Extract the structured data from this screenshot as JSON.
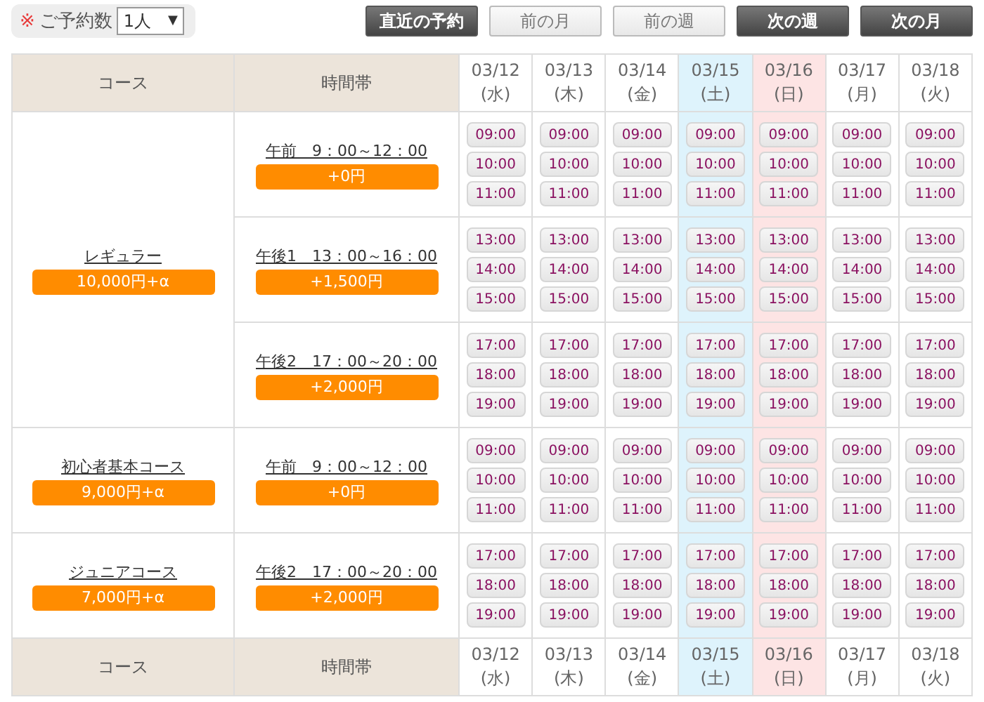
{
  "toolbar": {
    "count_label_mark": "※",
    "count_label": "ご予約数",
    "count_select": "1人",
    "count_select_arrow": "▼",
    "buttons": [
      {
        "label": "直近の予約",
        "disabled": false
      },
      {
        "label": "前の月",
        "disabled": true
      },
      {
        "label": "前の週",
        "disabled": true
      },
      {
        "label": "次の週",
        "disabled": false
      },
      {
        "label": "次の月",
        "disabled": false
      }
    ]
  },
  "table": {
    "header": {
      "course": "コース",
      "time": "時間帯",
      "days": [
        {
          "date": "03/12",
          "weekday": "(水)",
          "kind": "weekday"
        },
        {
          "date": "03/13",
          "weekday": "(木)",
          "kind": "weekday"
        },
        {
          "date": "03/14",
          "weekday": "(金)",
          "kind": "weekday"
        },
        {
          "date": "03/15",
          "weekday": "(土)",
          "kind": "saturday"
        },
        {
          "date": "03/16",
          "weekday": "(日)",
          "kind": "sunday"
        },
        {
          "date": "03/17",
          "weekday": "(月)",
          "kind": "weekday"
        },
        {
          "date": "03/18",
          "weekday": "(火)",
          "kind": "weekday"
        }
      ]
    },
    "courses": [
      {
        "name": "レギュラー",
        "price": "10,000円+α",
        "slots": [
          {
            "label": "午前　9：00～12：00",
            "extra": "+0円",
            "days": [
              [
                "09:00",
                "10:00",
                "11:00"
              ],
              [
                "09:00",
                "10:00",
                "11:00"
              ],
              [
                "09:00",
                "10:00",
                "11:00"
              ],
              [
                "09:00",
                "10:00",
                "11:00"
              ],
              [
                "09:00",
                "10:00",
                "11:00"
              ],
              [
                "09:00",
                "10:00",
                "11:00"
              ],
              [
                "09:00",
                "10:00",
                "11:00"
              ]
            ]
          },
          {
            "label": "午後1　13：00～16：00",
            "extra": "+1,500円",
            "days": [
              [
                "13:00",
                "14:00",
                "15:00"
              ],
              [
                "13:00",
                "14:00",
                "15:00"
              ],
              [
                "13:00",
                "14:00",
                "15:00"
              ],
              [
                "13:00",
                "14:00",
                "15:00"
              ],
              [
                "13:00",
                "14:00",
                "15:00"
              ],
              [
                "13:00",
                "14:00",
                "15:00"
              ],
              [
                "13:00",
                "14:00",
                "15:00"
              ]
            ]
          },
          {
            "label": "午後2　17：00～20：00",
            "extra": "+2,000円",
            "days": [
              [
                "17:00",
                "18:00",
                "19:00"
              ],
              [
                "17:00",
                "18:00",
                "19:00"
              ],
              [
                "17:00",
                "18:00",
                "19:00"
              ],
              [
                "17:00",
                "18:00",
                "19:00"
              ],
              [
                "17:00",
                "18:00",
                "19:00"
              ],
              [
                "17:00",
                "18:00",
                "19:00"
              ],
              [
                "17:00",
                "18:00",
                "19:00"
              ]
            ]
          }
        ]
      },
      {
        "name": "初心者基本コース",
        "price": "9,000円+α",
        "slots": [
          {
            "label": "午前　9：00～12：00",
            "extra": "+0円",
            "days": [
              [
                "09:00",
                "10:00",
                "11:00"
              ],
              [
                "09:00",
                "10:00",
                "11:00"
              ],
              [
                "09:00",
                "10:00",
                "11:00"
              ],
              [
                "09:00",
                "10:00",
                "11:00"
              ],
              [
                "09:00",
                "10:00",
                "11:00"
              ],
              [
                "09:00",
                "10:00",
                "11:00"
              ],
              [
                "09:00",
                "10:00",
                "11:00"
              ]
            ]
          }
        ]
      },
      {
        "name": "ジュニアコース",
        "price": "7,000円+α",
        "slots": [
          {
            "label": "午後2　17：00～20：00",
            "extra": "+2,000円",
            "days": [
              [
                "17:00",
                "18:00",
                "19:00"
              ],
              [
                "17:00",
                "18:00",
                "19:00"
              ],
              [
                "17:00",
                "18:00",
                "19:00"
              ],
              [
                "17:00",
                "18:00",
                "19:00"
              ],
              [
                "17:00",
                "18:00",
                "19:00"
              ],
              [
                "17:00",
                "18:00",
                "19:00"
              ],
              [
                "17:00",
                "18:00",
                "19:00"
              ]
            ]
          }
        ]
      }
    ],
    "footer": {
      "course": "コース",
      "time": "時間帯",
      "days": [
        {
          "date": "03/12",
          "weekday": "(水)",
          "kind": "weekday"
        },
        {
          "date": "03/13",
          "weekday": "(木)",
          "kind": "weekday"
        },
        {
          "date": "03/14",
          "weekday": "(金)",
          "kind": "weekday"
        },
        {
          "date": "03/15",
          "weekday": "(土)",
          "kind": "saturday"
        },
        {
          "date": "03/16",
          "weekday": "(日)",
          "kind": "sunday"
        },
        {
          "date": "03/17",
          "weekday": "(月)",
          "kind": "weekday"
        },
        {
          "date": "03/18",
          "weekday": "(火)",
          "kind": "weekday"
        }
      ]
    }
  }
}
